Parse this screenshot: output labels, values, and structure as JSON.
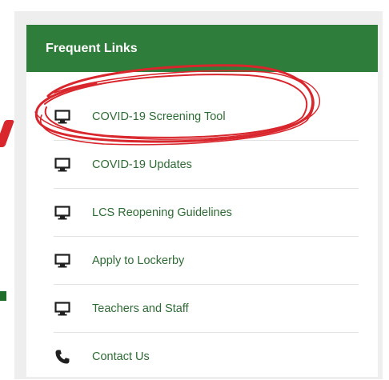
{
  "panel": {
    "title": "Frequent Links",
    "links": [
      {
        "label": "COVID-19 Screening Tool",
        "icon": "monitor-icon"
      },
      {
        "label": "COVID-19 Updates",
        "icon": "monitor-icon"
      },
      {
        "label": "LCS Reopening Guidelines",
        "icon": "monitor-icon"
      },
      {
        "label": "Apply to Lockerby",
        "icon": "monitor-icon"
      },
      {
        "label": "Teachers and Staff",
        "icon": "monitor-icon"
      },
      {
        "label": "Contact Us",
        "icon": "phone-icon"
      }
    ]
  },
  "colors": {
    "header_bg": "#2e7d3a",
    "link_text": "#2e6b34",
    "annotation": "#d8262c"
  }
}
